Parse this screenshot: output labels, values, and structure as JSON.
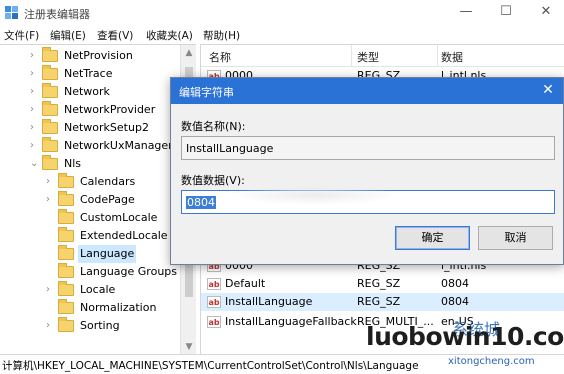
{
  "window": {
    "title": "注册表编辑器",
    "minimize": "—",
    "maximize": "☐",
    "close": "✕"
  },
  "menu": [
    "文件(F)",
    "编辑(E)",
    "查看(V)",
    "收藏夹(A)",
    "帮助(H)"
  ],
  "tree": [
    {
      "label": "NetProvision",
      "expander": "›",
      "selected": false
    },
    {
      "label": "NetTrace",
      "expander": "›",
      "selected": false
    },
    {
      "label": "Network",
      "expander": "›",
      "selected": false
    },
    {
      "label": "NetworkProvider",
      "expander": "›",
      "selected": false
    },
    {
      "label": "NetworkSetup2",
      "expander": "›",
      "selected": false
    },
    {
      "label": "NetworkUxManager",
      "expander": "›",
      "selected": false
    },
    {
      "label": "Nls",
      "expander": "⌄",
      "selected": false
    },
    {
      "label": "Calendars",
      "expander": "›",
      "selected": false
    },
    {
      "label": "CodePage",
      "expander": "›",
      "selected": false
    },
    {
      "label": "CustomLocale",
      "expander": "",
      "selected": false
    },
    {
      "label": "ExtendedLocale",
      "expander": "",
      "selected": false
    },
    {
      "label": "Language",
      "expander": "",
      "selected": true
    },
    {
      "label": "Language Groups",
      "expander": "",
      "selected": false
    },
    {
      "label": "Locale",
      "expander": "›",
      "selected": false
    },
    {
      "label": "Normalization",
      "expander": "",
      "selected": false
    },
    {
      "label": "Sorting",
      "expander": "›",
      "selected": false
    }
  ],
  "list": {
    "columns": [
      "名称",
      "类型",
      "数据"
    ],
    "rows": [
      {
        "name": "0000",
        "type": "REG_SZ",
        "data": "l_intl.nls",
        "selected": false
      },
      {
        "name": "Default",
        "type": "REG_SZ",
        "data": "0804",
        "selected": false
      },
      {
        "name": "InstallLanguage",
        "type": "REG_SZ",
        "data": "0804",
        "selected": true
      },
      {
        "name": "InstallLanguageFallback",
        "type": "REG_MULTI_...",
        "data": "en-US",
        "selected": false
      }
    ]
  },
  "dialog": {
    "title": "编辑字符串",
    "value_name_label": "数值名称(N):",
    "value_name": "InstallLanguage",
    "value_data_label": "数值数据(V):",
    "value_data": "0804",
    "ok": "确定",
    "cancel": "取消",
    "close": "✕"
  },
  "status": {
    "path": "计算机\\HKEY_LOCAL_MACHINE\\SYSTEM\\CurrentControlSet\\Control\\Nls\\Language"
  },
  "watermark": {
    "brand": "luobowin10.com",
    "sub": "xitongcheng.com",
    "cn": "系统城"
  },
  "colors": {
    "dialog_title_bg": "#2b72d7",
    "selection": "#cce8ff",
    "text_selection": "#3d7fd8"
  }
}
